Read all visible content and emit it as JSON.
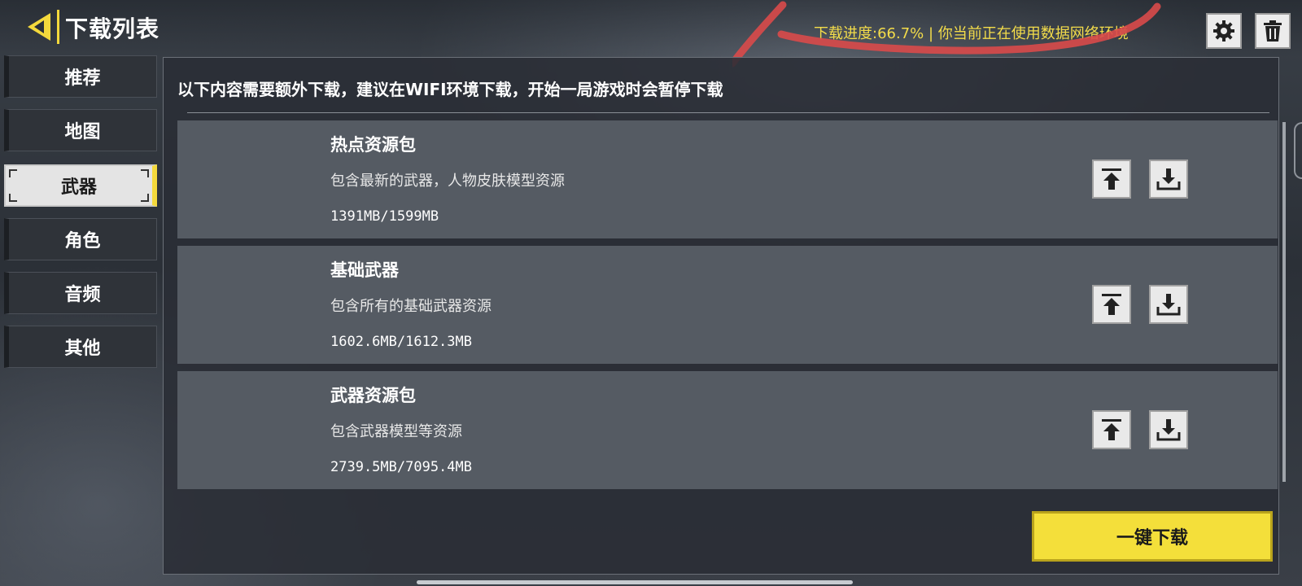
{
  "header": {
    "title": "下载列表",
    "status_text": "下载进度:66.7% | 你当前正在使用数据网络环境",
    "accent_color": "#f4d93c"
  },
  "toolbar": {
    "settings_icon": "gear-icon",
    "trash_icon": "trash-icon",
    "back_icon": "back-arrow-icon"
  },
  "sidebar": {
    "items": [
      {
        "label": "推荐",
        "active": false
      },
      {
        "label": "地图",
        "active": false
      },
      {
        "label": "武器",
        "active": true
      },
      {
        "label": "角色",
        "active": false
      },
      {
        "label": "音频",
        "active": false
      },
      {
        "label": "其他",
        "active": false
      }
    ]
  },
  "main": {
    "notice": "以下内容需要额外下载，建议在WIFI环境下载，开始一局游戏时会暂停下载",
    "packages": [
      {
        "title": "热点资源包",
        "description": "包含最新的武器，人物皮肤模型资源",
        "size": "1391MB/1599MB"
      },
      {
        "title": "基础武器",
        "description": "包含所有的基础武器资源",
        "size": "1602.6MB/1612.3MB"
      },
      {
        "title": "武器资源包",
        "description": "包含武器模型等资源",
        "size": "2739.5MB/7095.4MB"
      }
    ],
    "one_key_label": "一键下载"
  }
}
